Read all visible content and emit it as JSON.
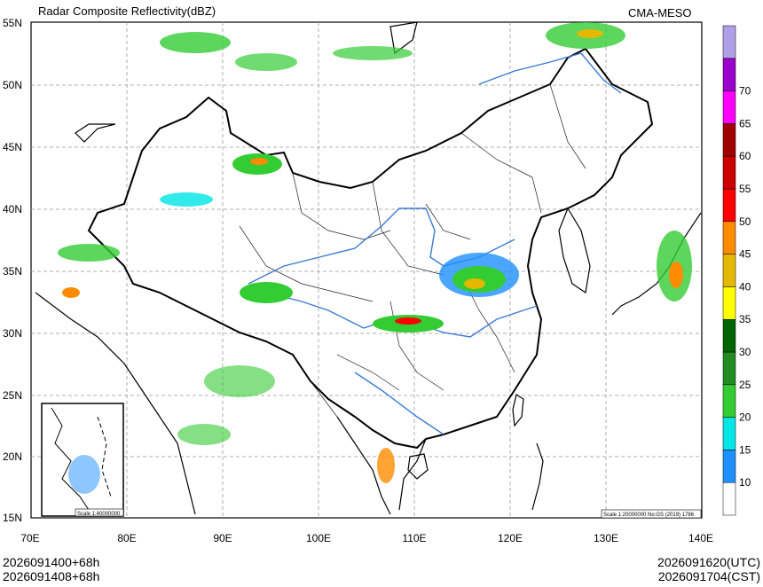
{
  "title": "Radar Composite Reflectivity(dBZ)",
  "source": "CMA-MESO",
  "lat_labels": [
    "55N",
    "50N",
    "45N",
    "40N",
    "35N",
    "30N",
    "25N",
    "20N",
    "15N"
  ],
  "lon_labels": [
    "70E",
    "80E",
    "90E",
    "100E",
    "110E",
    "120E",
    "130E",
    "140E"
  ],
  "colorbar": {
    "labels": [
      "10",
      "15",
      "20",
      "25",
      "30",
      "35",
      "40",
      "45",
      "50",
      "55",
      "60",
      "65",
      "70"
    ],
    "colors": [
      "#ffffff",
      "#1e90ff",
      "#00e5e5",
      "#33cc33",
      "#228b22",
      "#006400",
      "#ffff00",
      "#e5b800",
      "#ff8c00",
      "#ff0000",
      "#cc0000",
      "#a00000",
      "#ff00ff",
      "#9900cc",
      "#b0a0e8"
    ]
  },
  "inset_scale": "Scale 1:40000000",
  "map_scale": "Scale 1:20000000 No:GS (2019) 1786",
  "footer": {
    "left_line1": "2026091400+68h",
    "left_line2": "2026091408+68h",
    "right_line1": "2026091620(UTC)",
    "right_line2": "2026091704(CST)"
  }
}
